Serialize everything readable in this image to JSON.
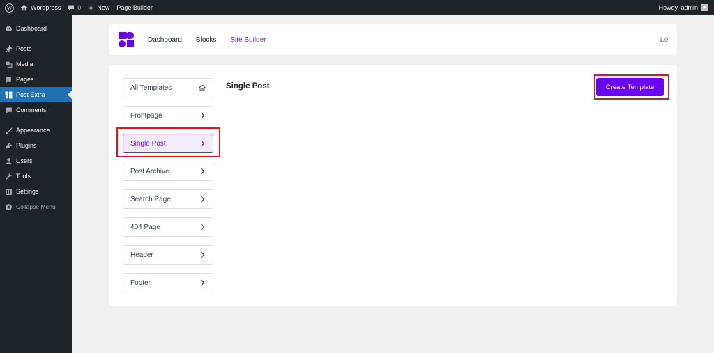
{
  "adminbar": {
    "site_name": "Wordpress",
    "comments_count": "0",
    "new_label": "New",
    "page_builder_label": "Page Builder",
    "howdy": "Howdy, admin"
  },
  "sidebar": {
    "items": [
      {
        "label": "Dashboard",
        "icon": "dashboard-icon"
      },
      {
        "label": "Posts",
        "icon": "pin-icon"
      },
      {
        "label": "Media",
        "icon": "media-icon"
      },
      {
        "label": "Pages",
        "icon": "pages-icon"
      },
      {
        "label": "Post Extra",
        "icon": "post-extra-icon"
      },
      {
        "label": "Comments",
        "icon": "comment-icon"
      },
      {
        "label": "Appearance",
        "icon": "brush-icon"
      },
      {
        "label": "Plugins",
        "icon": "plugin-icon"
      },
      {
        "label": "Users",
        "icon": "user-icon"
      },
      {
        "label": "Tools",
        "icon": "wrench-icon"
      },
      {
        "label": "Settings",
        "icon": "settings-icon"
      },
      {
        "label": "Collapse Menu",
        "icon": "collapse-icon"
      }
    ]
  },
  "header": {
    "nav": [
      "Dashboard",
      "Blocks",
      "Site Builder"
    ],
    "version": "1.0"
  },
  "templates": {
    "items": [
      "All Templates",
      "Frontpage",
      "Single Post",
      "Post Archive",
      "Search Page",
      "404 Page",
      "Header",
      "Footer"
    ],
    "active": "Single Post"
  },
  "main": {
    "heading": "Single Post",
    "create_button": "Create Template"
  },
  "colors": {
    "accent": "#6a00f5",
    "wp_blue": "#2271b1",
    "highlight": "#e8121f"
  }
}
